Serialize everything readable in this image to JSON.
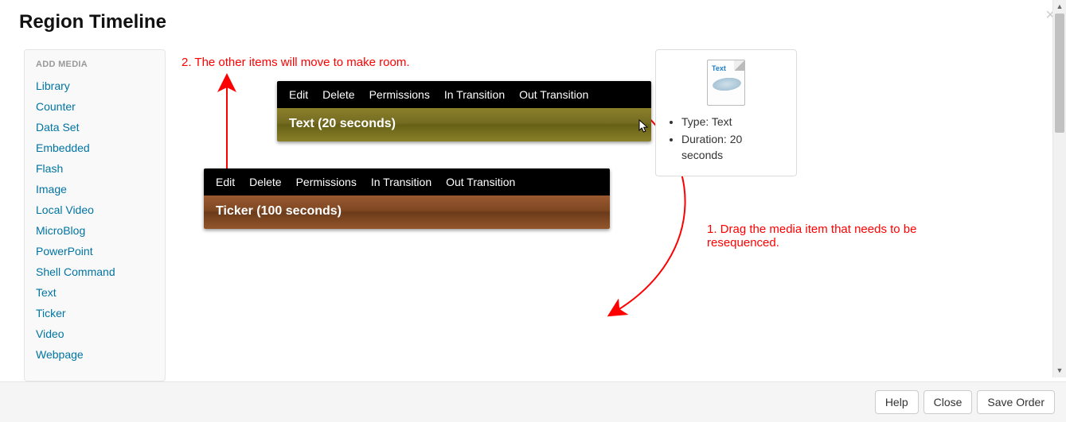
{
  "header": {
    "title": "Region Timeline",
    "close_glyph": "×"
  },
  "sidebar": {
    "heading": "ADD MEDIA",
    "items": [
      "Library",
      "Counter",
      "Data Set",
      "Embedded",
      "Flash",
      "Image",
      "Local Video",
      "MicroBlog",
      "PowerPoint",
      "Shell Command",
      "Text",
      "Ticker",
      "Video",
      "Webpage"
    ]
  },
  "actions": {
    "edit": "Edit",
    "delete": "Delete",
    "permissions": "Permissions",
    "in_transition": "In Transition",
    "out_transition": "Out Transition"
  },
  "items": {
    "dragging": {
      "title": "Text (20 seconds)"
    },
    "static": {
      "title": "Ticker (100 seconds)"
    }
  },
  "info": {
    "thumb_label": "Text",
    "type_label": "Type: Text",
    "duration_label": "Duration: 20 seconds"
  },
  "annotations": {
    "step1": "1. Drag the media item that needs to be resequenced.",
    "step2": "2. The other items will move to make room."
  },
  "footer": {
    "help": "Help",
    "close": "Close",
    "save_order": "Save Order"
  },
  "scroll": {
    "up": "▲",
    "down": "▼"
  }
}
